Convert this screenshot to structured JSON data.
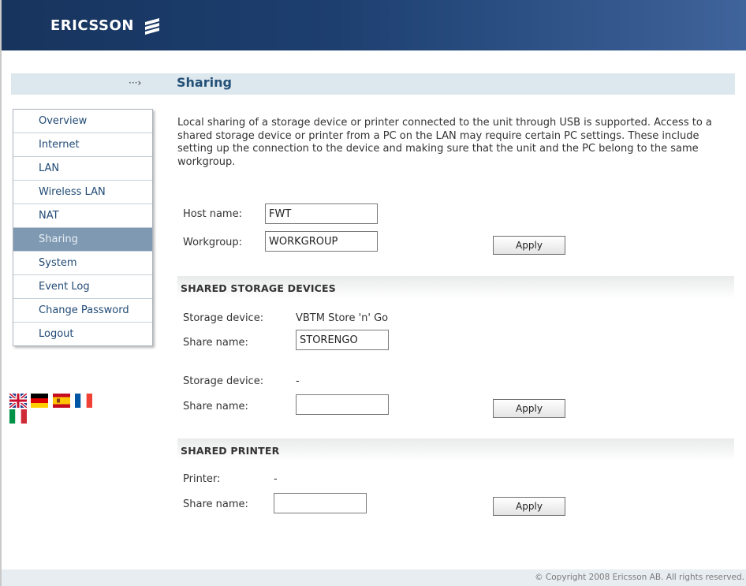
{
  "header": {
    "logo_text": "ERICSSON"
  },
  "page": {
    "title": "Sharing",
    "breadcrumb_arrow": "···›"
  },
  "sidebar": {
    "items": [
      {
        "label": "Overview"
      },
      {
        "label": "Internet"
      },
      {
        "label": "LAN"
      },
      {
        "label": "Wireless LAN"
      },
      {
        "label": "NAT"
      },
      {
        "label": "Sharing",
        "active": true
      },
      {
        "label": "System"
      },
      {
        "label": "Event Log"
      },
      {
        "label": "Change Password"
      },
      {
        "label": "Logout"
      }
    ]
  },
  "languages": [
    "English",
    "German",
    "Spanish",
    "French",
    "Italian"
  ],
  "intro": "Local sharing of a storage device or printer connected to the unit through USB is supported. Access to a shared storage device or printer from a PC on the LAN may require certain PC settings. These include setting up the connection to the device and making sure that the unit and the PC belong to the same workgroup.",
  "general": {
    "host_label": "Host name:",
    "host_value": "FWT",
    "workgroup_label": "Workgroup:",
    "workgroup_value": "WORKGROUP",
    "apply": "Apply"
  },
  "storage": {
    "title": "SHARED STORAGE DEVICES",
    "device_label": "Storage device:",
    "share_label": "Share name:",
    "devices": [
      {
        "device": "VBTM Store 'n' Go",
        "share_value": "STORENGO"
      },
      {
        "device": "-",
        "share_value": ""
      }
    ],
    "apply": "Apply"
  },
  "printer": {
    "title": "SHARED PRINTER",
    "printer_label": "Printer:",
    "printer_value": "-",
    "share_label": "Share name:",
    "share_value": "",
    "apply": "Apply"
  },
  "footer": {
    "copyright": "© Copyright 2008 Ericsson AB. All rights reserved."
  },
  "colors": {
    "header": "#1d3f70",
    "title": "#245078",
    "nav_active": "#7f99b3",
    "titlebar": "#dde8ee"
  }
}
